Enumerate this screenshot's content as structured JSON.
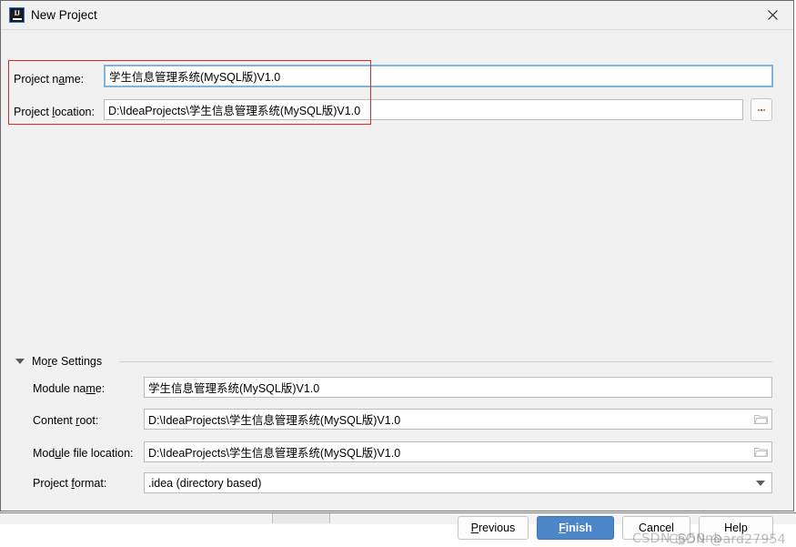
{
  "window": {
    "title": "New Project",
    "app_icon": "intellij-idea-icon",
    "icon_text": "IJ",
    "close_label": "×"
  },
  "form": {
    "project_name": {
      "label_before": "Project n",
      "label_mnemonic": "a",
      "label_after": "me:",
      "value": "学生信息管理系统(MySQL版)V1.0",
      "focused": true
    },
    "project_location": {
      "label_before": "Project ",
      "label_mnemonic": "l",
      "label_after": "ocation:",
      "value": "D:\\IdeaProjects\\学生信息管理系统(MySQL版)V1.0",
      "browse_label": "...",
      "browse_icon": "ellipsis-icon"
    }
  },
  "more_settings": {
    "label_before": "Mo",
    "label_mnemonic": "r",
    "label_after": "e Settings",
    "expanded": true,
    "triangle_icon": "chevron-down-icon",
    "rows": [
      {
        "label_before": "Module na",
        "label_mnemonic": "m",
        "label_after": "e:",
        "value": "学生信息管理系统(MySQL版)V1.0",
        "icon": "none"
      },
      {
        "label_before": "Content ",
        "label_mnemonic": "r",
        "label_after": "oot:",
        "value": "D:\\IdeaProjects\\学生信息管理系统(MySQL版)V1.0",
        "icon": "folder-icon"
      },
      {
        "label_before": "Mod",
        "label_mnemonic": "u",
        "label_after": "le file location:",
        "value": "D:\\IdeaProjects\\学生信息管理系统(MySQL版)V1.0",
        "icon": "folder-icon"
      },
      {
        "label_before": "Project ",
        "label_mnemonic": "f",
        "label_after": "ormat:",
        "value": ".idea (directory based)",
        "icon": "chevron-down-icon"
      }
    ]
  },
  "buttons": {
    "previous": {
      "before": "",
      "mnemonic": "P",
      "after": "revious"
    },
    "finish": {
      "before": "",
      "mnemonic": "F",
      "after": "inish"
    },
    "cancel": {
      "before": "Cancel",
      "mnemonic": "",
      "after": ""
    },
    "help": {
      "before": "Help",
      "mnemonic": "",
      "after": ""
    }
  },
  "watermark": {
    "line_a": "CSDN @50nb",
    "line_b": "CSDN @ard27954"
  },
  "colors": {
    "dialog_bg": "#f1f1f1",
    "field_bg": "#ffffff",
    "focus_border": "#7eb4e2",
    "primary_button": "#4a86c8",
    "annotation_red": "#ee2222"
  }
}
